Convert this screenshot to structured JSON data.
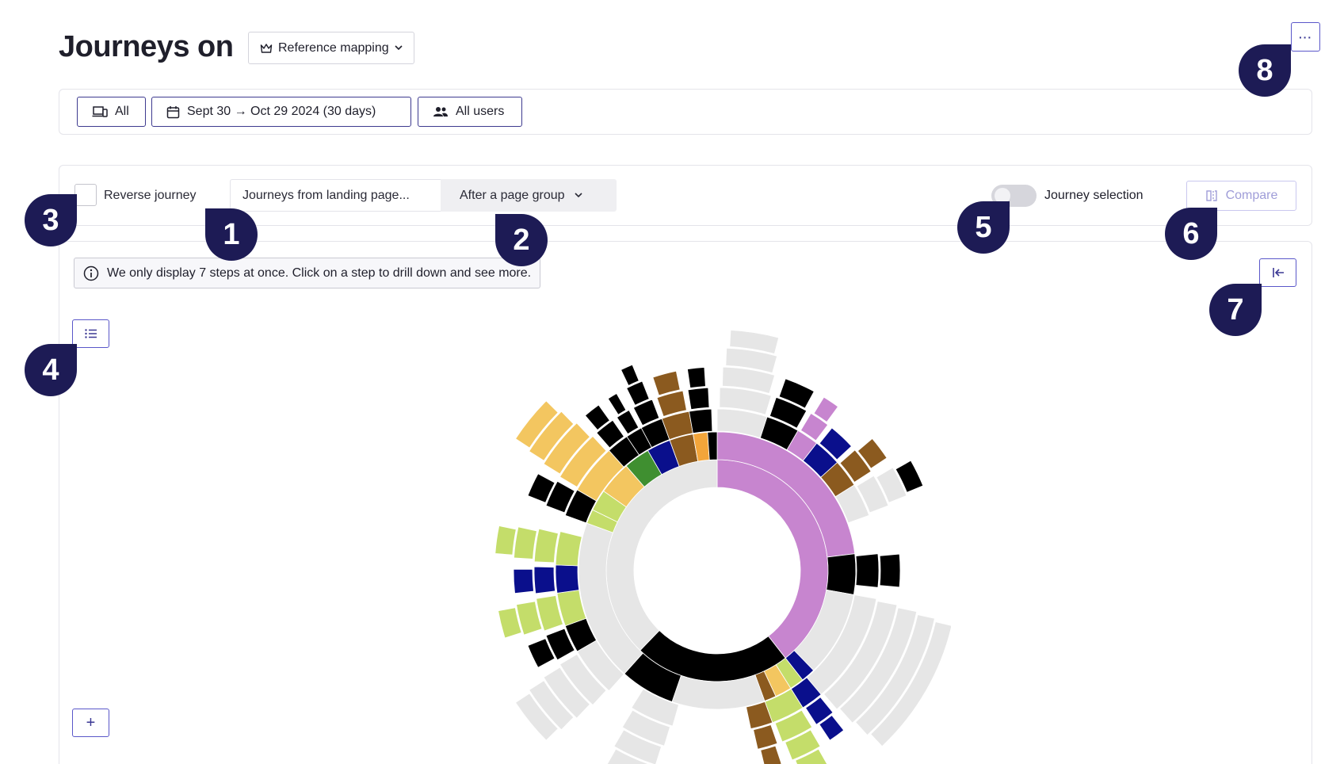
{
  "header": {
    "title": "Journeys on",
    "mapping_label": "Reference mapping",
    "more_label": "···"
  },
  "filters": {
    "device_label": "All",
    "date_label": "Sept 30 → Oct 29 2024 (30 days)",
    "segment_label": "All users"
  },
  "controls": {
    "reverse_label": "Reverse journey",
    "journey_type_label": "Journeys from landing page...",
    "page_group_label": "After a page group",
    "journey_selection_label": "Journey selection",
    "compare_label": "Compare"
  },
  "chart": {
    "info_text": "We only display 7 steps at once. Click on a step to drill down and see more.",
    "zoom_label": "+"
  },
  "callouts": [
    "1",
    "2",
    "3",
    "4",
    "5",
    "6",
    "7",
    "8"
  ],
  "colors": {
    "accent": "#3d3a8f",
    "callout": "#1d1b55",
    "purple": "#c785cf",
    "black": "#000000",
    "grey": "#e6e6e6",
    "olive": "#c4dd6a",
    "navy": "#0a0f8c",
    "brown": "#8b5a1f",
    "green": "#3f8f30",
    "yellow": "#f3c660",
    "orange": "#f3a53a"
  }
}
